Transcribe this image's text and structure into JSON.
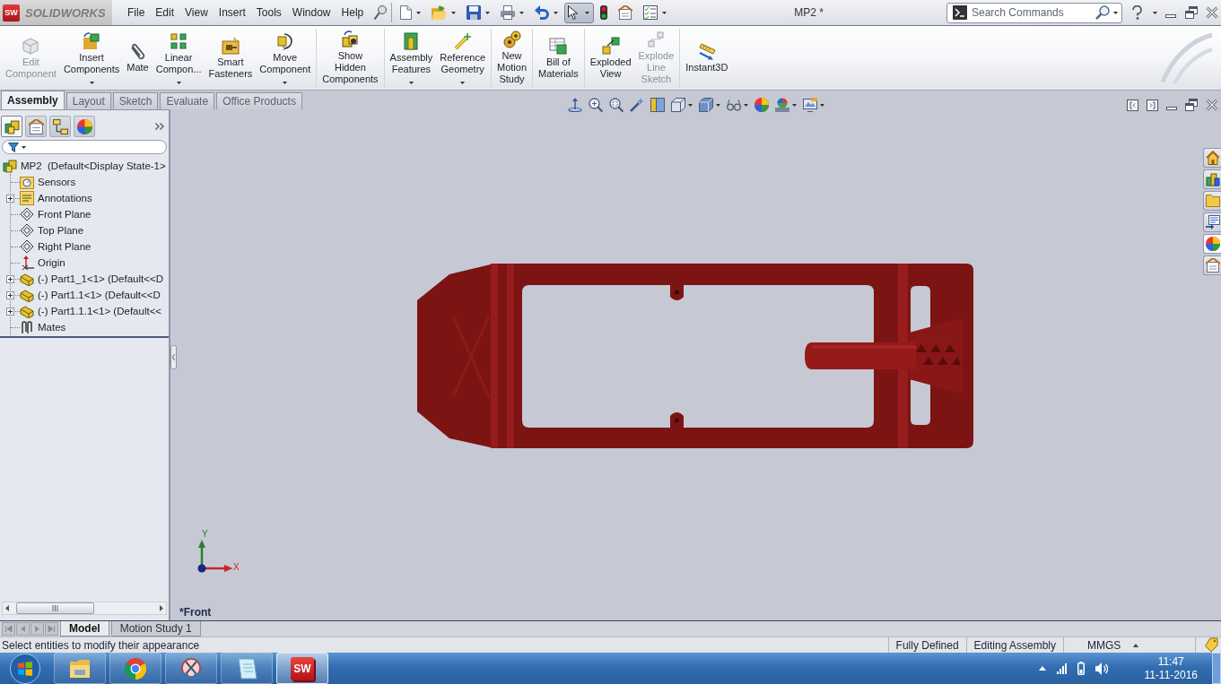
{
  "title_bar": {
    "logo_mark": "SW",
    "app_name": "SOLIDWORKS",
    "menu": [
      "File",
      "Edit",
      "View",
      "Insert",
      "Tools",
      "Window",
      "Help"
    ],
    "quick_access": [
      {
        "menu": true,
        "pressed": false
      },
      {
        "menu": true,
        "pressed": false
      },
      {
        "menu": true,
        "pressed": false
      },
      {
        "menu": true,
        "pressed": false
      },
      {
        "menu": true,
        "pressed": false
      },
      {
        "menu": true,
        "pressed": true
      },
      {
        "menu": false,
        "pressed": false
      },
      {
        "menu": false,
        "pressed": false
      },
      {
        "menu": true,
        "pressed": false
      }
    ],
    "document_title": "MP2 *",
    "search": {
      "placeholder": "Search Commands"
    }
  },
  "command_manager": {
    "groups": [
      {
        "commands": [
          {
            "label": "Edit Component",
            "disabled": true,
            "menu": false
          },
          {
            "label": "Insert Components",
            "disabled": false,
            "menu": true
          },
          {
            "label": "Mate",
            "disabled": false,
            "menu": false
          },
          {
            "label": "Linear Compon...",
            "disabled": false,
            "menu": true
          },
          {
            "label": "Smart Fasteners",
            "disabled": false,
            "menu": false
          },
          {
            "label": "Move Component",
            "disabled": false,
            "menu": true
          }
        ]
      },
      {
        "commands": [
          {
            "label": "Show Hidden Components",
            "disabled": false,
            "menu": false
          }
        ]
      },
      {
        "commands": [
          {
            "label": "Assembly Features",
            "disabled": false,
            "menu": true
          },
          {
            "label": "Reference Geometry",
            "disabled": false,
            "menu": true
          }
        ]
      },
      {
        "commands": [
          {
            "label": "New Motion Study",
            "disabled": false,
            "menu": false
          }
        ]
      },
      {
        "commands": [
          {
            "label": "Bill of Materials",
            "disabled": false,
            "menu": false
          }
        ]
      },
      {
        "commands": [
          {
            "label": "Exploded View",
            "disabled": false,
            "menu": false
          },
          {
            "label": "Explode Line Sketch",
            "disabled": true,
            "menu": false
          }
        ]
      },
      {
        "commands": [
          {
            "label": "Instant3D",
            "disabled": false,
            "menu": false
          }
        ]
      }
    ],
    "tabs": [
      {
        "label": "Assembly",
        "selected": true
      },
      {
        "label": "Layout",
        "selected": false
      },
      {
        "label": "Sketch",
        "selected": false
      },
      {
        "label": "Evaluate",
        "selected": false
      },
      {
        "label": "Office Products",
        "selected": false
      }
    ]
  },
  "feature_manager": {
    "panel_tabs": [
      {
        "selected": true
      },
      {
        "selected": false
      },
      {
        "selected": false
      },
      {
        "selected": false
      }
    ],
    "tree": {
      "label": "MP2  (Default<Display State-1>",
      "kind": "assembly",
      "children": [
        {
          "label": "Sensors",
          "kind": "sensors"
        },
        {
          "label": "Annotations",
          "kind": "annotations",
          "expanded": false
        },
        {
          "label": "Front Plane",
          "kind": "plane"
        },
        {
          "label": "Top Plane",
          "kind": "plane"
        },
        {
          "label": "Right Plane",
          "kind": "plane"
        },
        {
          "label": "Origin",
          "kind": "origin"
        },
        {
          "label": "(-) Part1_1<1> (Default<<D",
          "kind": "part",
          "expanded": false
        },
        {
          "label": "(-) Part1.1<1> (Default<<D",
          "kind": "part",
          "expanded": false
        },
        {
          "label": "(-) Part1.1.1<1> (Default<<",
          "kind": "part",
          "expanded": false
        },
        {
          "label": "Mates",
          "kind": "mates"
        }
      ]
    }
  },
  "graphics": {
    "view_name": "*Front",
    "triad": {
      "y_label": "Y",
      "x_label": "X"
    },
    "task_pane_tabs": [
      {
        "selected": false
      },
      {
        "selected": false
      },
      {
        "selected": false
      },
      {
        "selected": false
      },
      {
        "selected": true
      },
      {
        "selected": false
      }
    ]
  },
  "bottom_tabs": [
    {
      "label": "Model",
      "selected": true
    },
    {
      "label": "Motion Study 1",
      "selected": false
    }
  ],
  "status_bar": {
    "message": "Select entities to modify their appearance",
    "sections": [
      {
        "text": "Fully Defined",
        "menu": false
      },
      {
        "text": "Editing Assembly",
        "menu": false
      },
      {
        "text": "MMGS",
        "menu": true
      }
    ]
  },
  "taskbar": {
    "apps": [
      {
        "kind": "folder",
        "active": false
      },
      {
        "kind": "browser",
        "active": false
      },
      {
        "kind": "snipping",
        "active": false
      },
      {
        "kind": "notes",
        "active": false
      },
      {
        "kind": "cad",
        "active": true,
        "label": "SW"
      }
    ],
    "clock": {
      "time": "11:47",
      "date": "11-11-2016"
    }
  }
}
